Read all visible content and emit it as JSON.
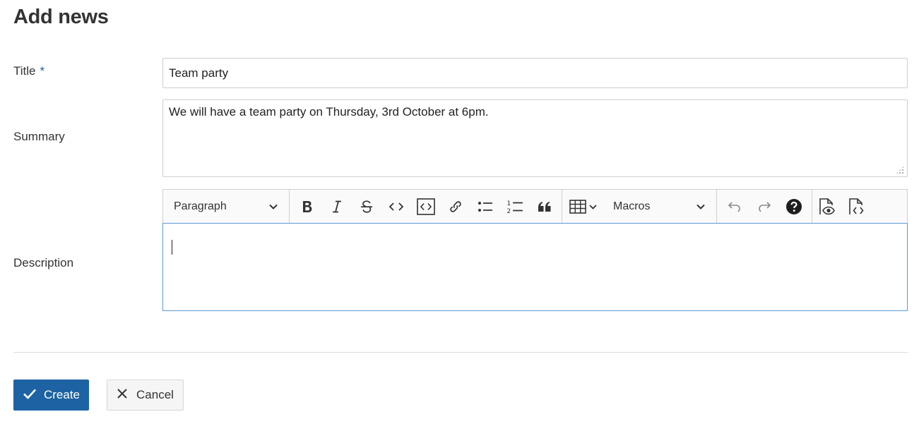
{
  "page": {
    "title": "Add news"
  },
  "form": {
    "title_label": "Title",
    "required_marker": "*",
    "title_value": "Team party",
    "summary_label": "Summary",
    "summary_value": "We will have a team party on Thursday, 3rd October at 6pm.",
    "description_label": "Description"
  },
  "toolbar": {
    "heading_select": "Paragraph",
    "macros_select": "Macros",
    "buttons": [
      {
        "name": "bold-button",
        "icon": "bold-icon"
      },
      {
        "name": "italic-button",
        "icon": "italic-icon"
      },
      {
        "name": "strikethrough-button",
        "icon": "strikethrough-icon"
      },
      {
        "name": "inline-code-button",
        "icon": "code-icon"
      },
      {
        "name": "code-block-button",
        "icon": "code-block-icon"
      },
      {
        "name": "link-button",
        "icon": "link-icon"
      },
      {
        "name": "bulleted-list-button",
        "icon": "bulleted-list-icon"
      },
      {
        "name": "numbered-list-button",
        "icon": "numbered-list-icon"
      },
      {
        "name": "blockquote-button",
        "icon": "quote-icon"
      },
      {
        "name": "table-button",
        "icon": "table-icon"
      },
      {
        "name": "undo-button",
        "icon": "undo-icon"
      },
      {
        "name": "redo-button",
        "icon": "redo-icon"
      },
      {
        "name": "help-button",
        "icon": "help-icon"
      },
      {
        "name": "preview-button",
        "icon": "preview-icon"
      },
      {
        "name": "source-button",
        "icon": "source-icon"
      }
    ],
    "colors": {
      "icon": "#333333",
      "disabled_icon": "#8a8a8a"
    }
  },
  "actions": {
    "create_label": "Create",
    "cancel_label": "Cancel"
  },
  "colors": {
    "primary": "#1d63a3",
    "required": "#1f5f99",
    "editor_focus_border": "#5b9bd5"
  }
}
